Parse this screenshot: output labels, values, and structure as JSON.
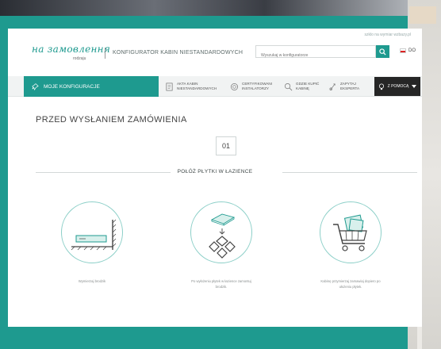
{
  "header": {
    "logo": "на замовлення",
    "logo_sub": "rodzaju",
    "tagline": "KONFIGURATOR KABIN NIESTANDARDOWYCH",
    "top_link": "szklo na wymiar wzbazy.pl",
    "search_placeholder": "Wyszukaj w konfiguratorze",
    "lang": "DO"
  },
  "nav": {
    "my_configs": "MOJE KONFIGURACJE",
    "items": [
      {
        "line1": "AKTA KABIN",
        "line2": "NIESTANDARDOWYCH",
        "icon": "document-icon"
      },
      {
        "line1": "CERTYFIKOWANI",
        "line2": "INSTALATORZY",
        "icon": "certificate-icon"
      },
      {
        "line1": "GDZIE KUPIĆ",
        "line2": "KABINĘ",
        "icon": "location-search-icon"
      },
      {
        "line1": "ZAPYTAJ",
        "line2": "EKSPERTA",
        "icon": "expert-icon"
      }
    ],
    "help": "Z POMOCĄ"
  },
  "main": {
    "title": "PRZED WYSŁANIEM ZAMÓWIENIA",
    "step": "01",
    "section": "POŁÓŻ PŁYTKI W ŁAZIENCE",
    "cards": [
      {
        "icon": "shower-tray-icon",
        "caption_1": "Wymierzaj brodzik",
        "caption_2": ""
      },
      {
        "icon": "tiles-icon",
        "caption_1": "Po wyłożeniu płytek w łazience zamontuj",
        "caption_2": "brodzik."
      },
      {
        "icon": "shopping-cart-icon",
        "caption_1": "Kabinę przymierzaj zamawiaj dopiero po",
        "caption_2": "ułożeniu płytek."
      }
    ]
  },
  "colors": {
    "accent": "#1e9a8f",
    "dark": "#262626"
  }
}
